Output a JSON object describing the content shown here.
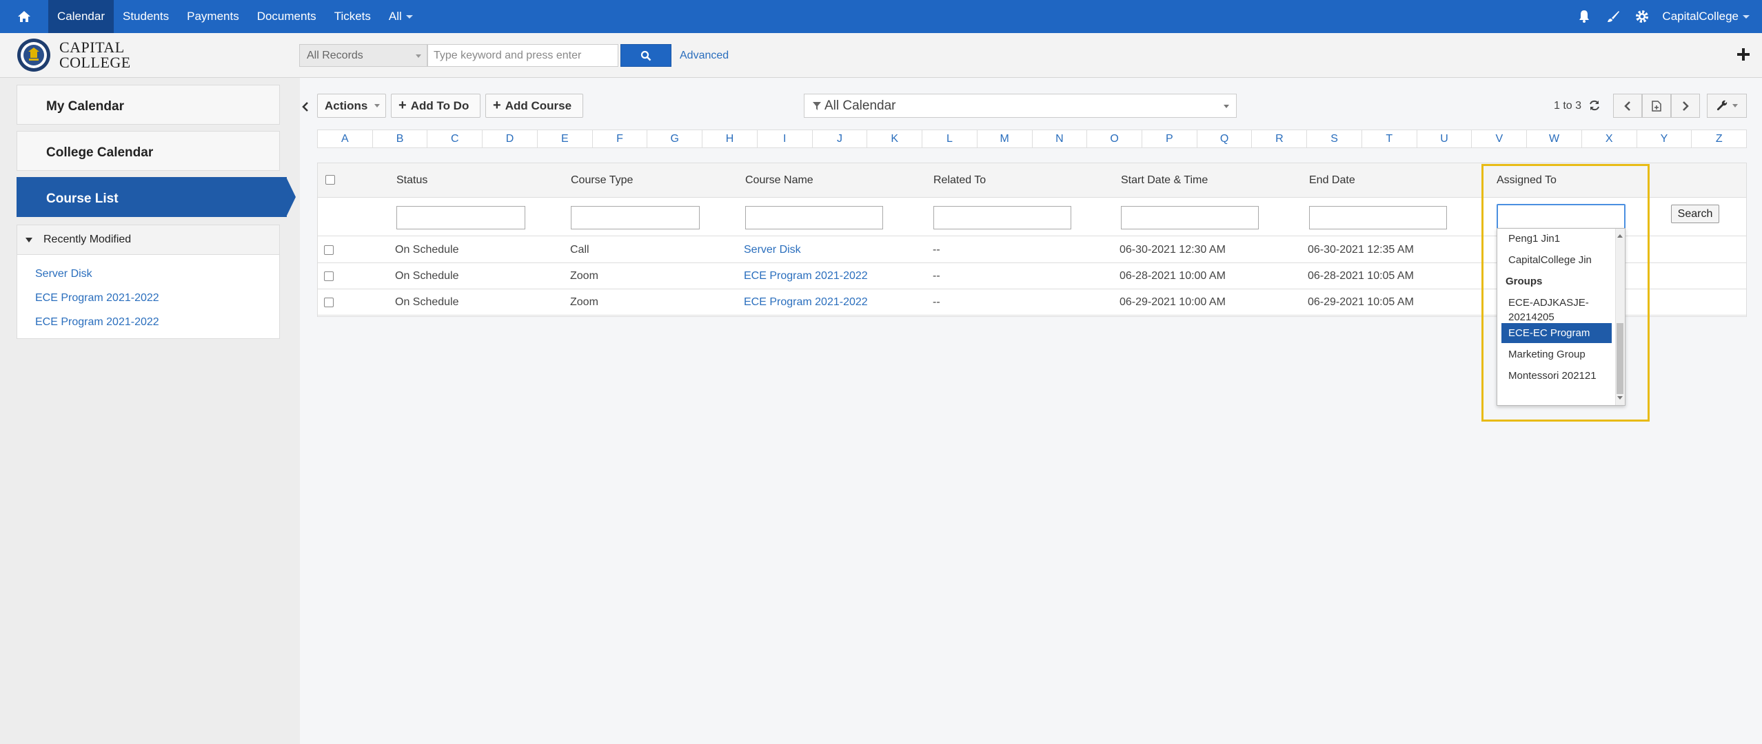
{
  "topnav": {
    "home_icon": "home-icon",
    "items": [
      "Calendar",
      "Students",
      "Payments",
      "Documents",
      "Tickets",
      "All"
    ],
    "active": "Calendar",
    "right_icons": [
      "bell-icon",
      "brush-icon",
      "gear-icon"
    ],
    "user": "CapitalCollege"
  },
  "subbar": {
    "logo_line1": "CAPITAL",
    "logo_line2": "COLLEGE",
    "records_select": "All Records",
    "search_placeholder": "Type keyword and press enter",
    "advanced_label": "Advanced"
  },
  "sidebar": {
    "items": [
      "My Calendar",
      "College Calendar",
      "Course List"
    ],
    "active": "Course List",
    "recent_title": "Recently Modified",
    "recent_links": [
      "Server Disk",
      "ECE Program 2021-2022",
      "ECE Program 2021-2022"
    ]
  },
  "toolbar": {
    "actions_label": "Actions",
    "add_todo_label": "Add To Do",
    "add_course_label": "Add Course",
    "calendar_filter": "All Calendar",
    "pager_text": "1 to 3"
  },
  "alphabet": [
    "A",
    "B",
    "C",
    "D",
    "E",
    "F",
    "G",
    "H",
    "I",
    "J",
    "K",
    "L",
    "M",
    "N",
    "O",
    "P",
    "Q",
    "R",
    "S",
    "T",
    "U",
    "V",
    "W",
    "X",
    "Y",
    "Z"
  ],
  "table": {
    "headers": [
      "Status",
      "Course Type",
      "Course Name",
      "Related To",
      "Start Date & Time",
      "End Date",
      "Assigned To"
    ],
    "search_label": "Search",
    "rows": [
      {
        "status": "On Schedule",
        "type": "Call",
        "name": "Server Disk",
        "related": "--",
        "start": "06-30-2021 12:30 AM",
        "end": "06-30-2021 12:35 AM"
      },
      {
        "status": "On Schedule",
        "type": "Zoom",
        "name": "ECE Program 2021-2022",
        "related": "--",
        "start": "06-28-2021 10:00 AM",
        "end": "06-28-2021 10:05 AM"
      },
      {
        "status": "On Schedule",
        "type": "Zoom",
        "name": "ECE Program 2021-2022",
        "related": "--",
        "start": "06-29-2021 10:00 AM",
        "end": "06-29-2021 10:05 AM"
      }
    ]
  },
  "assigned_dropdown": {
    "items": [
      {
        "label": "Peng1 Jin1",
        "kind": "user"
      },
      {
        "label": "CapitalCollege Jin",
        "kind": "user"
      },
      {
        "label": "Groups",
        "kind": "group"
      },
      {
        "label": "ECE-ADJKASJE-20214205",
        "kind": "user"
      },
      {
        "label": "ECE-EC Program",
        "kind": "selected"
      },
      {
        "label": "Marketing Group",
        "kind": "user"
      },
      {
        "label": "Montessori 202121",
        "kind": "user"
      }
    ]
  },
  "colors": {
    "primary": "#1f66c2",
    "nav_active": "#14458a",
    "sidebar_active": "#1f5ba8",
    "link": "#2a6ebd",
    "highlight": "#e8bb16"
  }
}
